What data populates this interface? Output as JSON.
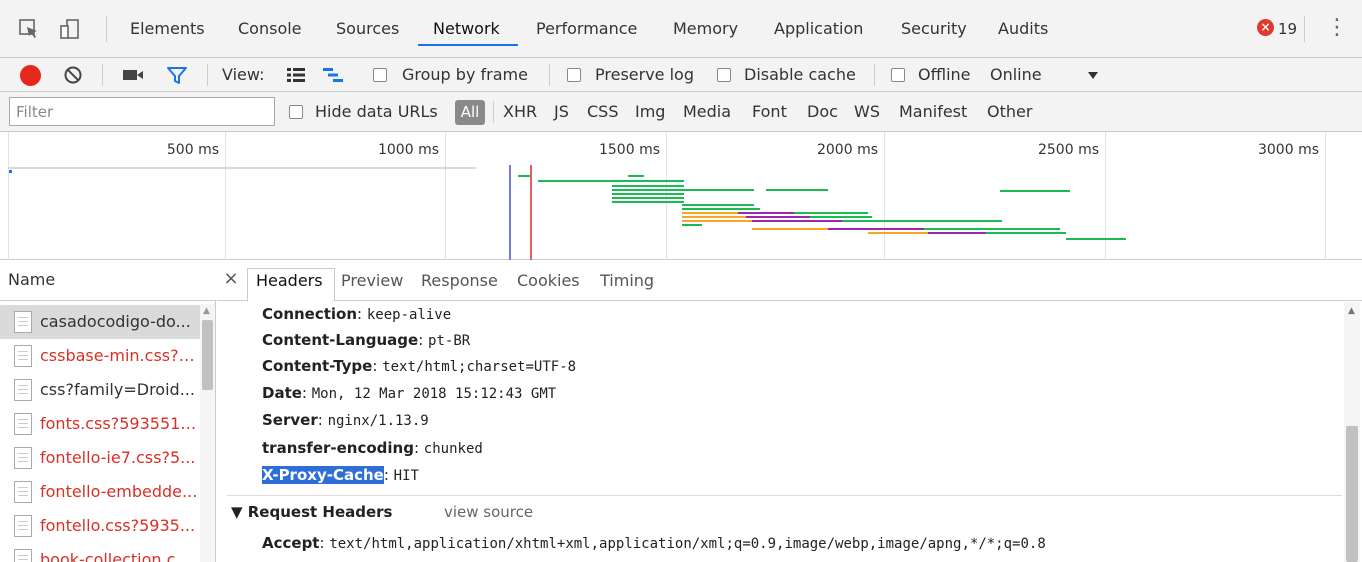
{
  "tabs": {
    "items": [
      "Elements",
      "Console",
      "Sources",
      "Network",
      "Performance",
      "Memory",
      "Application",
      "Security",
      "Audits"
    ],
    "active": "Network",
    "error_count": "19"
  },
  "toolbar": {
    "view_label": "View:",
    "group_by_frame": "Group by frame",
    "preserve_log": "Preserve log",
    "disable_cache": "Disable cache",
    "offline": "Offline",
    "throttle": "Online"
  },
  "filter": {
    "placeholder": "Filter",
    "hide_data_urls": "Hide data URLs",
    "types": [
      "All",
      "XHR",
      "JS",
      "CSS",
      "Img",
      "Media",
      "Font",
      "Doc",
      "WS",
      "Manifest",
      "Other"
    ]
  },
  "timeline": {
    "ticks": [
      "500 ms",
      "1000 ms",
      "1500 ms",
      "2000 ms",
      "2500 ms",
      "3000 ms"
    ],
    "colors": {
      "green": "#1db954",
      "orange": "#f5a623",
      "purple": "#9b27af",
      "blue": "#7b7bd6",
      "red": "#e06060"
    }
  },
  "requests": {
    "header": "Name",
    "rows": [
      {
        "name": "casadocodigo-do...",
        "error": false,
        "selected": true
      },
      {
        "name": "cssbase-min.css?5...",
        "error": true,
        "selected": false
      },
      {
        "name": "css?family=Droid...",
        "error": false,
        "selected": false
      },
      {
        "name": "fonts.css?5935512...",
        "error": true,
        "selected": false
      },
      {
        "name": "fontello-ie7.css?5...",
        "error": true,
        "selected": false
      },
      {
        "name": "fontello-embedde...",
        "error": true,
        "selected": false
      },
      {
        "name": "fontello.css?5935...",
        "error": true,
        "selected": false
      },
      {
        "name": "book-collection.cs...",
        "error": true,
        "selected": false
      }
    ]
  },
  "details": {
    "tabs": [
      "Headers",
      "Preview",
      "Response",
      "Cookies",
      "Timing"
    ],
    "active_tab": "Headers",
    "response_headers": [
      {
        "key": "Connection",
        "value": "keep-alive"
      },
      {
        "key": "Content-Language",
        "value": "pt-BR"
      },
      {
        "key": "Content-Type",
        "value": "text/html;charset=UTF-8"
      },
      {
        "key": "Date",
        "value": "Mon, 12 Mar 2018 15:12:43 GMT"
      },
      {
        "key": "Server",
        "value": "nginx/1.13.9"
      },
      {
        "key": "transfer-encoding",
        "value": "chunked"
      },
      {
        "key": "X-Proxy-Cache",
        "value": "HIT"
      }
    ],
    "request_section": "▼ Request Headers",
    "view_source": "view source",
    "request_headers": [
      {
        "key": "Accept",
        "value": "text/html,application/xhtml+xml,application/xml;q=0.9,image/webp,image/apng,*/*;q=0.8"
      }
    ]
  }
}
